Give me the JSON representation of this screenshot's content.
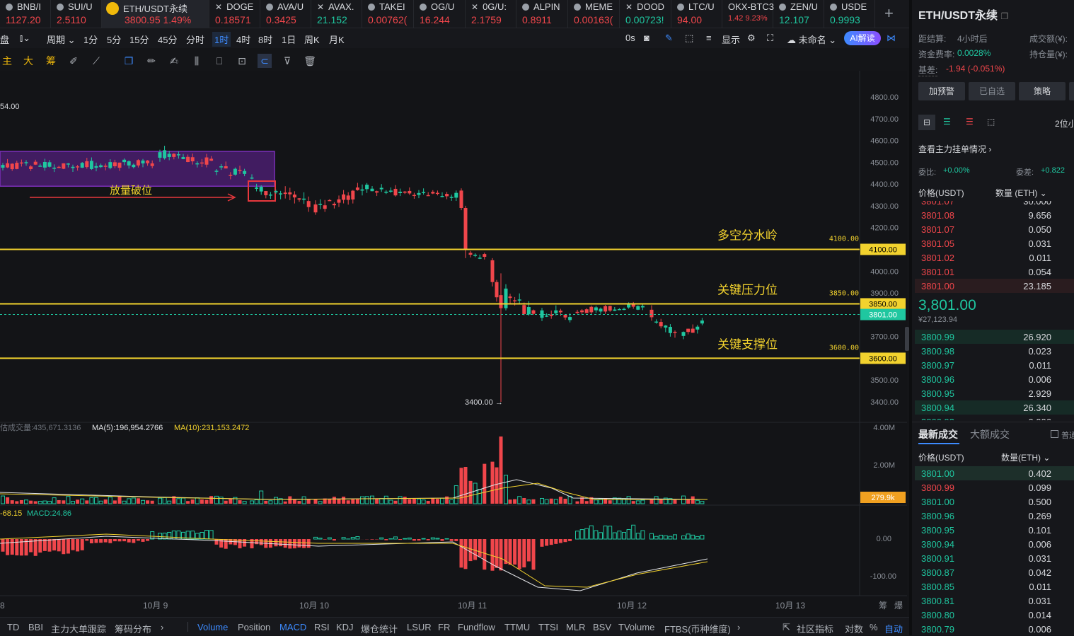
{
  "tickers": [
    {
      "name": "BNB/I",
      "price": "1127.20",
      "dir": "red",
      "icon": "dot",
      "w": 72
    },
    {
      "name": "SUI/U",
      "price": "2.5110",
      "dir": "red",
      "icon": "dot",
      "w": 72
    },
    {
      "name": "ETH/USDT永续",
      "price": "3800.95",
      "change": "1.49%",
      "dir": "red",
      "icon": "bnb",
      "w": 152,
      "active": true
    },
    {
      "name": "DOGE",
      "price": "0.18571",
      "dir": "red",
      "icon": "x",
      "w": 72
    },
    {
      "name": "AVA/U",
      "price": "0.3425",
      "dir": "red",
      "icon": "dot",
      "w": 72
    },
    {
      "name": "AVAX.",
      "price": "21.152",
      "dir": "green",
      "icon": "x",
      "w": 72
    },
    {
      "name": "TAKEI",
      "price": "0.00762(",
      "dir": "red",
      "icon": "dot",
      "w": 73
    },
    {
      "name": "OG/U",
      "price": "16.244",
      "dir": "red",
      "icon": "dot",
      "w": 73
    },
    {
      "name": "0G/U:",
      "price": "2.1759",
      "dir": "red",
      "icon": "x",
      "w": 72
    },
    {
      "name": "ALPIN",
      "price": "0.8911",
      "dir": "red",
      "icon": "dot",
      "w": 73
    },
    {
      "name": "MEME",
      "price": "0.00163(",
      "dir": "red",
      "icon": "dot",
      "w": 73
    },
    {
      "name": "DOOD",
      "price": "0.00723!",
      "dir": "green",
      "icon": "x",
      "w": 73
    },
    {
      "name": "LTC/U",
      "price": "94.00",
      "dir": "red",
      "icon": "dot",
      "w": 72
    },
    {
      "name": "OKX-BTC3",
      "price": "1.42",
      "change": "9.23%",
      "dir": "red",
      "icon": "none",
      "w": 72
    },
    {
      "name": "ZEN/U",
      "price": "12.107",
      "dir": "green",
      "icon": "dot",
      "w": 72
    },
    {
      "name": "USDE",
      "price": "0.9993",
      "dir": "green",
      "icon": "dot",
      "w": 72
    }
  ],
  "toolbar1": {
    "left_label": "盘",
    "chart_type_icon": "candle-type-icon",
    "period_label": "周期",
    "intervals": [
      "1分",
      "5分",
      "15分",
      "45分",
      "分时",
      "1时",
      "4时",
      "8时",
      "1日",
      "周K",
      "月K"
    ],
    "selected_interval": "1时",
    "countdown": "0s",
    "display_label": "显示",
    "layout_name": "未命名",
    "ai_label": "AI解读"
  },
  "toolbar2": {
    "chars": [
      "主",
      "大",
      "筹"
    ]
  },
  "chart_data": {
    "type": "candlestick",
    "symbol": "ETH/USDT永续",
    "interval": "1时",
    "y_range": [
      3330,
      4850
    ],
    "y_ticks": [
      "4800.00",
      "4700.00",
      "4600.00",
      "4500.00",
      "4400.00",
      "4300.00",
      "4200.00",
      "4100.00",
      "4000.00",
      "3900.00",
      "3850.00",
      "3800.00",
      "3700.00",
      "3600.00",
      "3500.00",
      "3400.00"
    ],
    "x_ticks": [
      "8",
      "10月 9",
      "10月 10",
      "10月 11",
      "10月 12",
      "10月 13"
    ],
    "partial_top_label": "54.00",
    "current_price_tag": "3801.00",
    "levels": [
      {
        "price": 4100,
        "label": "多空分水岭",
        "value_label": "4100.00",
        "tag": "4100.00"
      },
      {
        "price": 3850,
        "label": "关键压力位",
        "value_label": "3850.00",
        "tag": "3850.00"
      },
      {
        "price": 3600,
        "label": "关键支撑位",
        "value_label": "3600.00",
        "tag": "3600.00"
      }
    ],
    "box_label": "放量破位",
    "low_marker": "3400.00",
    "volume": {
      "caption_prefix": "估成交量:435,671.3136",
      "ma5": "MA(5):196,954.2766",
      "ma10": "MA(10):231,153.2472",
      "ticks": [
        "4.00M",
        "2.00M"
      ],
      "last_tag": "279.9k"
    },
    "macd": {
      "caption_a": "-68.15",
      "caption_b": "MACD:24.86",
      "ticks": [
        "0.00",
        "-100.00"
      ]
    },
    "bottom_right": [
      "筹",
      "爆"
    ],
    "colors": {
      "up": "#1fc7a0",
      "down": "#f0464b",
      "level": "#f2d22e",
      "box": "#7b2fb8"
    }
  },
  "orderbook": {
    "title": "ETH/USDT永续",
    "settle_label": "距结算:",
    "settle_value": "4小时后",
    "volume_label": "成交额(¥):",
    "funding_label": "资金费率:",
    "funding_value": "0.0028%",
    "oi_label": "持仓量(¥):",
    "basis_label": "基差:",
    "basis_value": "-1.94 (-0.051%)",
    "buttons": [
      "加预警",
      "已自选",
      "策略"
    ],
    "depth_label": "2位小",
    "main_orders_link": "查看主力挂单情况",
    "ratio_label": "委比:",
    "ratio_value": "+0.00%",
    "diff_label": "委差:",
    "diff_value": "+0.822",
    "price_col": "价格(USDT)",
    "qty_col": "数量 (ETH)",
    "asks": [
      {
        "p": "3801.07",
        "q": "30.000"
      },
      {
        "p": "3801.08",
        "q": "9.656"
      },
      {
        "p": "3801.07",
        "q": "0.050"
      },
      {
        "p": "3801.05",
        "q": "0.031"
      },
      {
        "p": "3801.02",
        "q": "0.011"
      },
      {
        "p": "3801.01",
        "q": "0.054"
      },
      {
        "p": "3801.00",
        "q": "23.185"
      }
    ],
    "last_price": "3,801.00",
    "last_cny": "¥27,123.94",
    "bids": [
      {
        "p": "3800.99",
        "q": "26.920"
      },
      {
        "p": "3800.98",
        "q": "0.023"
      },
      {
        "p": "3800.97",
        "q": "0.011"
      },
      {
        "p": "3800.96",
        "q": "0.006"
      },
      {
        "p": "3800.95",
        "q": "2.929"
      },
      {
        "p": "3800.94",
        "q": "26.340"
      },
      {
        "p": "3800.93",
        "q": "0.006"
      }
    ],
    "trades_tab": "最新成交",
    "bigtrades_tab": "大额成交",
    "normal_label": "普通",
    "trades_price_col": "价格(USDT)",
    "trades_qty_col": "数量(ETH)",
    "trades": [
      {
        "p": "3801.00",
        "q": "0.402",
        "d": "green",
        "hl": true
      },
      {
        "p": "3800.99",
        "q": "0.099",
        "d": "red"
      },
      {
        "p": "3801.00",
        "q": "0.500",
        "d": "green"
      },
      {
        "p": "3800.96",
        "q": "0.269",
        "d": "green"
      },
      {
        "p": "3800.95",
        "q": "0.101",
        "d": "green"
      },
      {
        "p": "3800.94",
        "q": "0.006",
        "d": "green"
      },
      {
        "p": "3800.91",
        "q": "0.031",
        "d": "green"
      },
      {
        "p": "3800.87",
        "q": "0.042",
        "d": "green"
      },
      {
        "p": "3800.85",
        "q": "0.011",
        "d": "green"
      },
      {
        "p": "3800.81",
        "q": "0.031",
        "d": "green"
      },
      {
        "p": "3800.80",
        "q": "0.014",
        "d": "green"
      },
      {
        "p": "3800.79",
        "q": "0.006",
        "d": "green"
      }
    ]
  },
  "bottombar": {
    "items": [
      "TD",
      "BBI",
      "主力大单跟踪",
      "筹码分布",
      "Volume",
      "Position",
      "MACD",
      "RSI",
      "KDJ",
      "爆仓统计",
      "LSUR",
      "FR",
      "Fundflow",
      "TTMU",
      "TTSI",
      "MLR",
      "BSV",
      "TVolume",
      "FTBS(币种维度)"
    ],
    "active": [
      "Volume",
      "MACD"
    ],
    "community": "社区指标",
    "log_label": "对数",
    "pct_label": "%",
    "auto_label": "自动"
  }
}
